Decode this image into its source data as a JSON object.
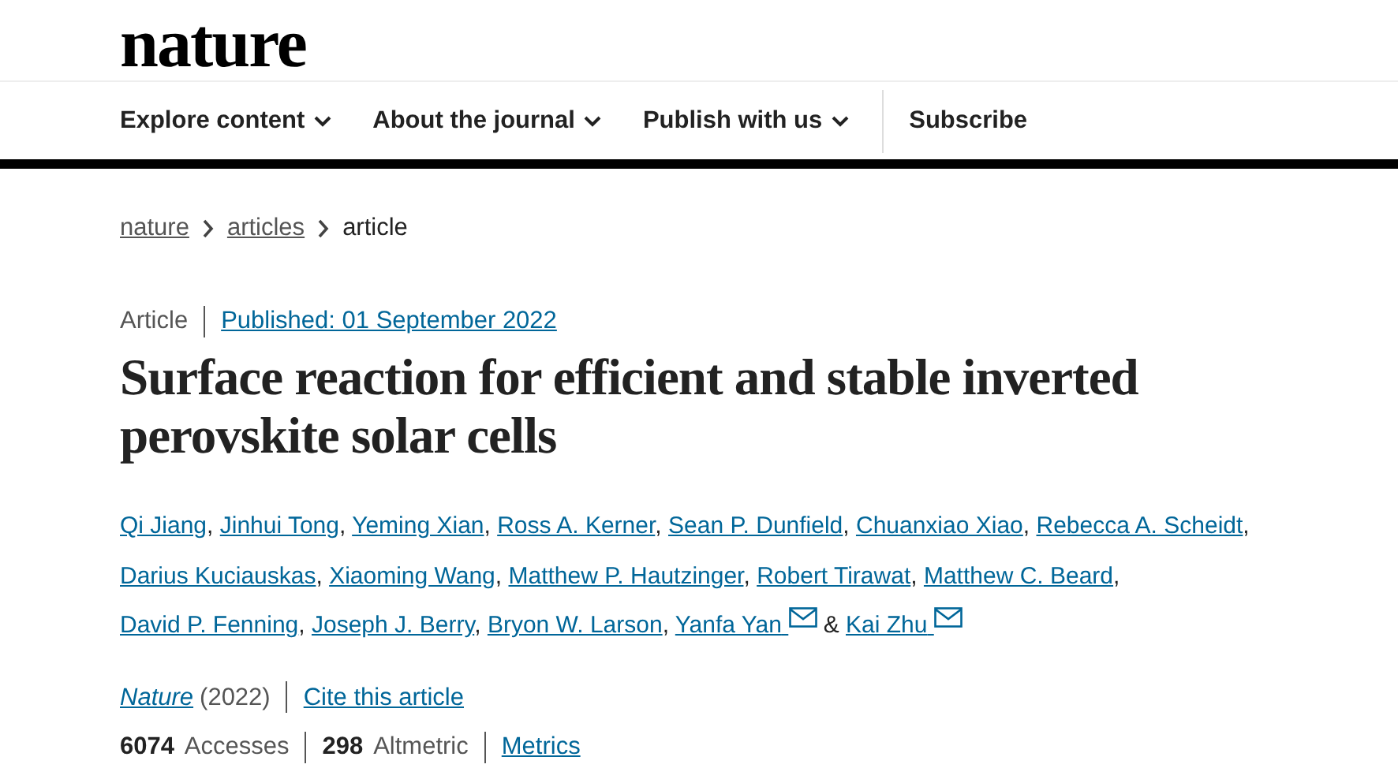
{
  "logo": "nature",
  "nav": [
    {
      "label": "Explore content",
      "dropdown": true
    },
    {
      "label": "About the journal",
      "dropdown": true
    },
    {
      "label": "Publish with us",
      "dropdown": true
    },
    {
      "label": "Subscribe",
      "dropdown": false
    }
  ],
  "breadcrumb": [
    {
      "label": "nature",
      "current": false
    },
    {
      "label": "articles",
      "current": false
    },
    {
      "label": "article",
      "current": true
    }
  ],
  "article_type": "Article",
  "published": "Published: 01 September 2022",
  "title": "Surface reaction for efficient and stable inverted perovskite solar cells",
  "authors": [
    {
      "name": "Qi Jiang",
      "email": false,
      "separator": ","
    },
    {
      "name": "Jinhui Tong",
      "email": false,
      "separator": ","
    },
    {
      "name": "Yeming Xian",
      "email": false,
      "separator": ","
    },
    {
      "name": "Ross A. Kerner",
      "email": false,
      "separator": ","
    },
    {
      "name": "Sean P. Dunfield",
      "email": false,
      "separator": ","
    },
    {
      "name": "Chuanxiao Xiao",
      "email": false,
      "separator": ","
    },
    {
      "name": "Rebecca A. Scheidt",
      "email": false,
      "separator": ","
    },
    {
      "name": "Darius Kuciauskas",
      "email": false,
      "separator": ","
    },
    {
      "name": "Xiaoming Wang",
      "email": false,
      "separator": ","
    },
    {
      "name": "Matthew P. Hautzinger",
      "email": false,
      "separator": ","
    },
    {
      "name": "Robert Tirawat",
      "email": false,
      "separator": ","
    },
    {
      "name": "Matthew C. Beard",
      "email": false,
      "separator": ","
    },
    {
      "name": "David P. Fenning",
      "email": false,
      "separator": ","
    },
    {
      "name": "Joseph J. Berry",
      "email": false,
      "separator": ","
    },
    {
      "name": "Bryon W. Larson",
      "email": false,
      "separator": ","
    },
    {
      "name": "Yanfa Yan",
      "email": true,
      "separator": "&"
    },
    {
      "name": "Kai Zhu",
      "email": true
    }
  ],
  "journal": "Nature",
  "year": "(2022)",
  "cite": "Cite this article",
  "metrics": [
    "**6074** Accesses",
    "**298** Altmetric"
  ],
  "metrics_link": "Metrics"
}
